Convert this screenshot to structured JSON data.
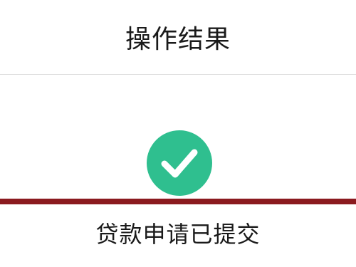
{
  "header": {
    "title": "操作结果"
  },
  "result": {
    "icon": "check-circle-icon",
    "icon_color": "#2fbf8f",
    "message": "贷款申请已提交"
  },
  "colors": {
    "highlight_line": "#8b1a1f"
  }
}
